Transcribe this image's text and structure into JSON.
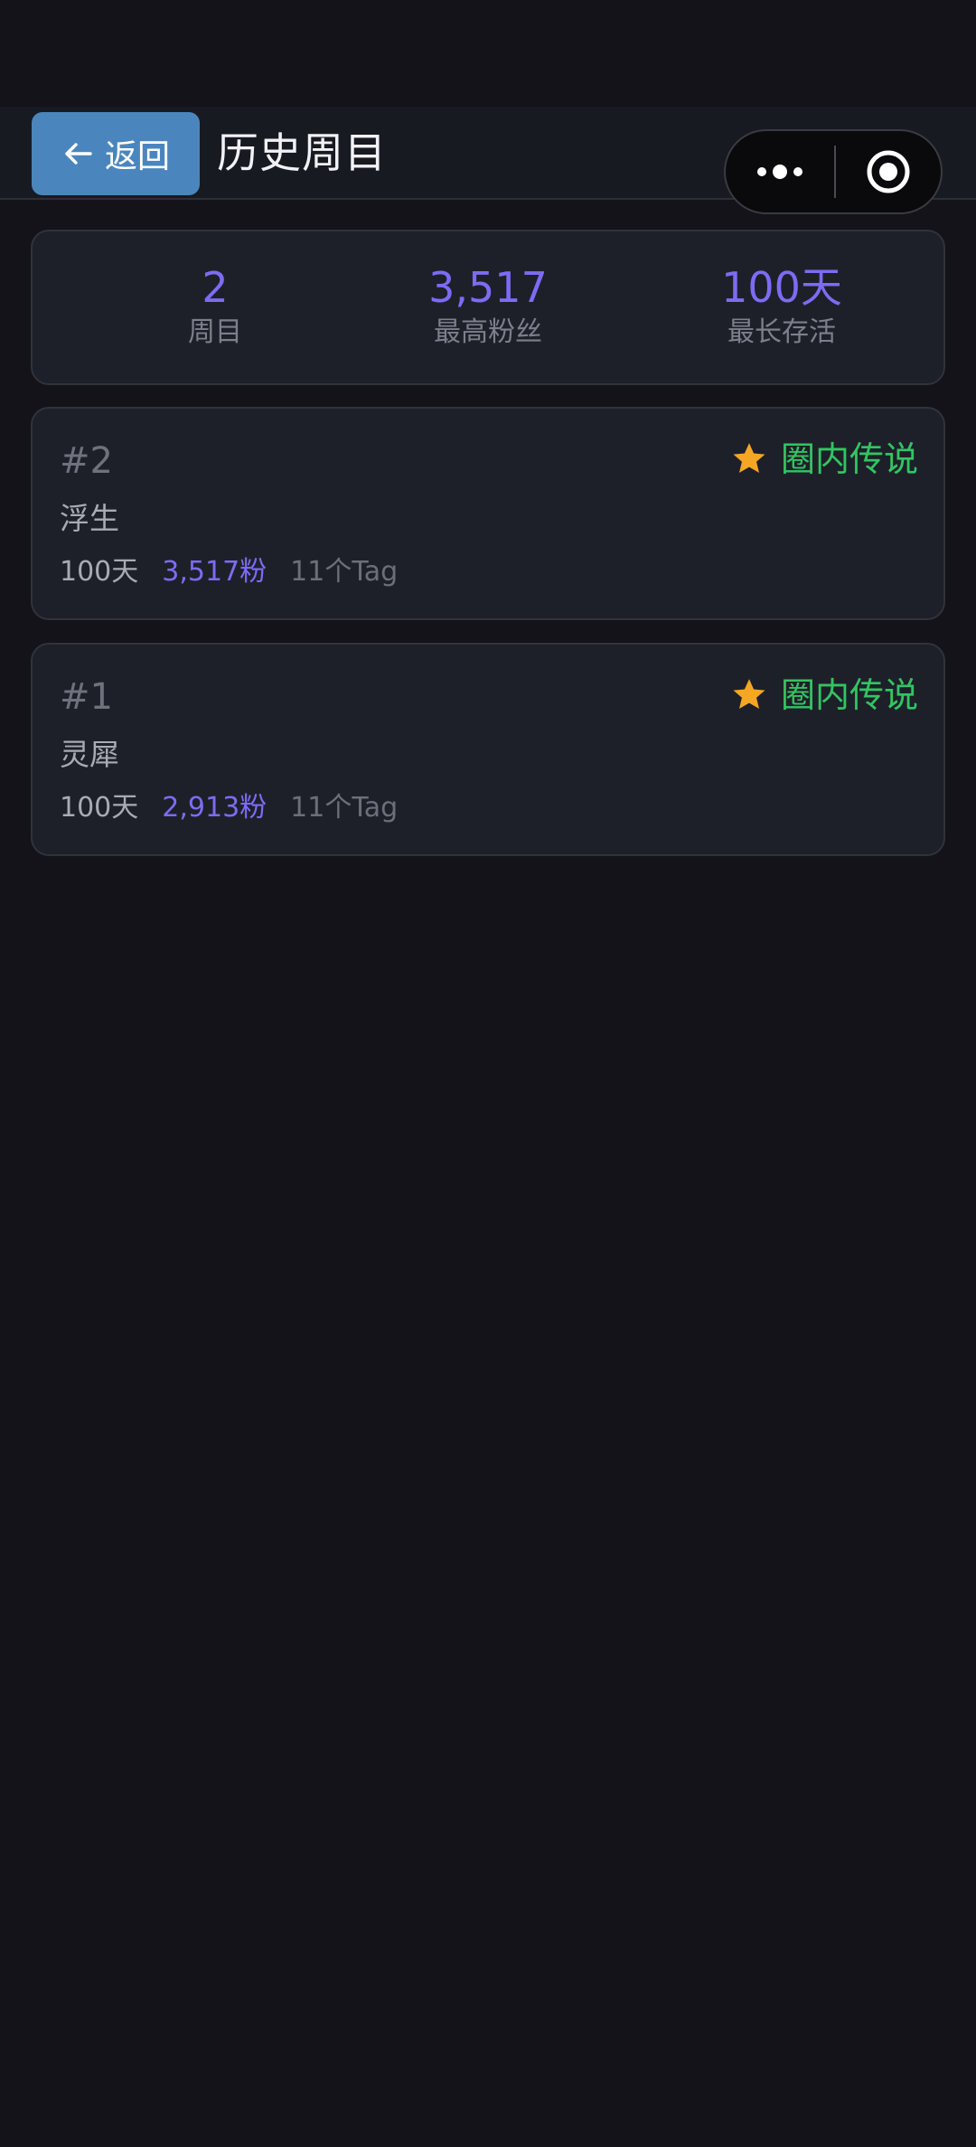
{
  "header": {
    "back_label": "返回",
    "title": "历史周目"
  },
  "capsule": {
    "more_icon": "more-dots-icon",
    "close_icon": "target-circle-icon"
  },
  "summary": {
    "runs_value": "2",
    "runs_label": "周目",
    "max_fans_value": "3,517",
    "max_fans_label": "最高粉丝",
    "longest_value": "100天",
    "longest_label": "最长存活"
  },
  "runs": [
    {
      "number": "#2",
      "badge": "圈内传说",
      "name": "浮生",
      "days": "100天",
      "fans": "3,517粉",
      "tags": "11个Tag"
    },
    {
      "number": "#1",
      "badge": "圈内传说",
      "name": "灵犀",
      "days": "100天",
      "fans": "2,913粉",
      "tags": "11个Tag"
    }
  ],
  "colors": {
    "background": "#131319",
    "card": "#1e2029",
    "accent": "#7c6cf4",
    "badge": "#33c463",
    "star": "#f5a623",
    "back_button": "#4a86bd"
  }
}
